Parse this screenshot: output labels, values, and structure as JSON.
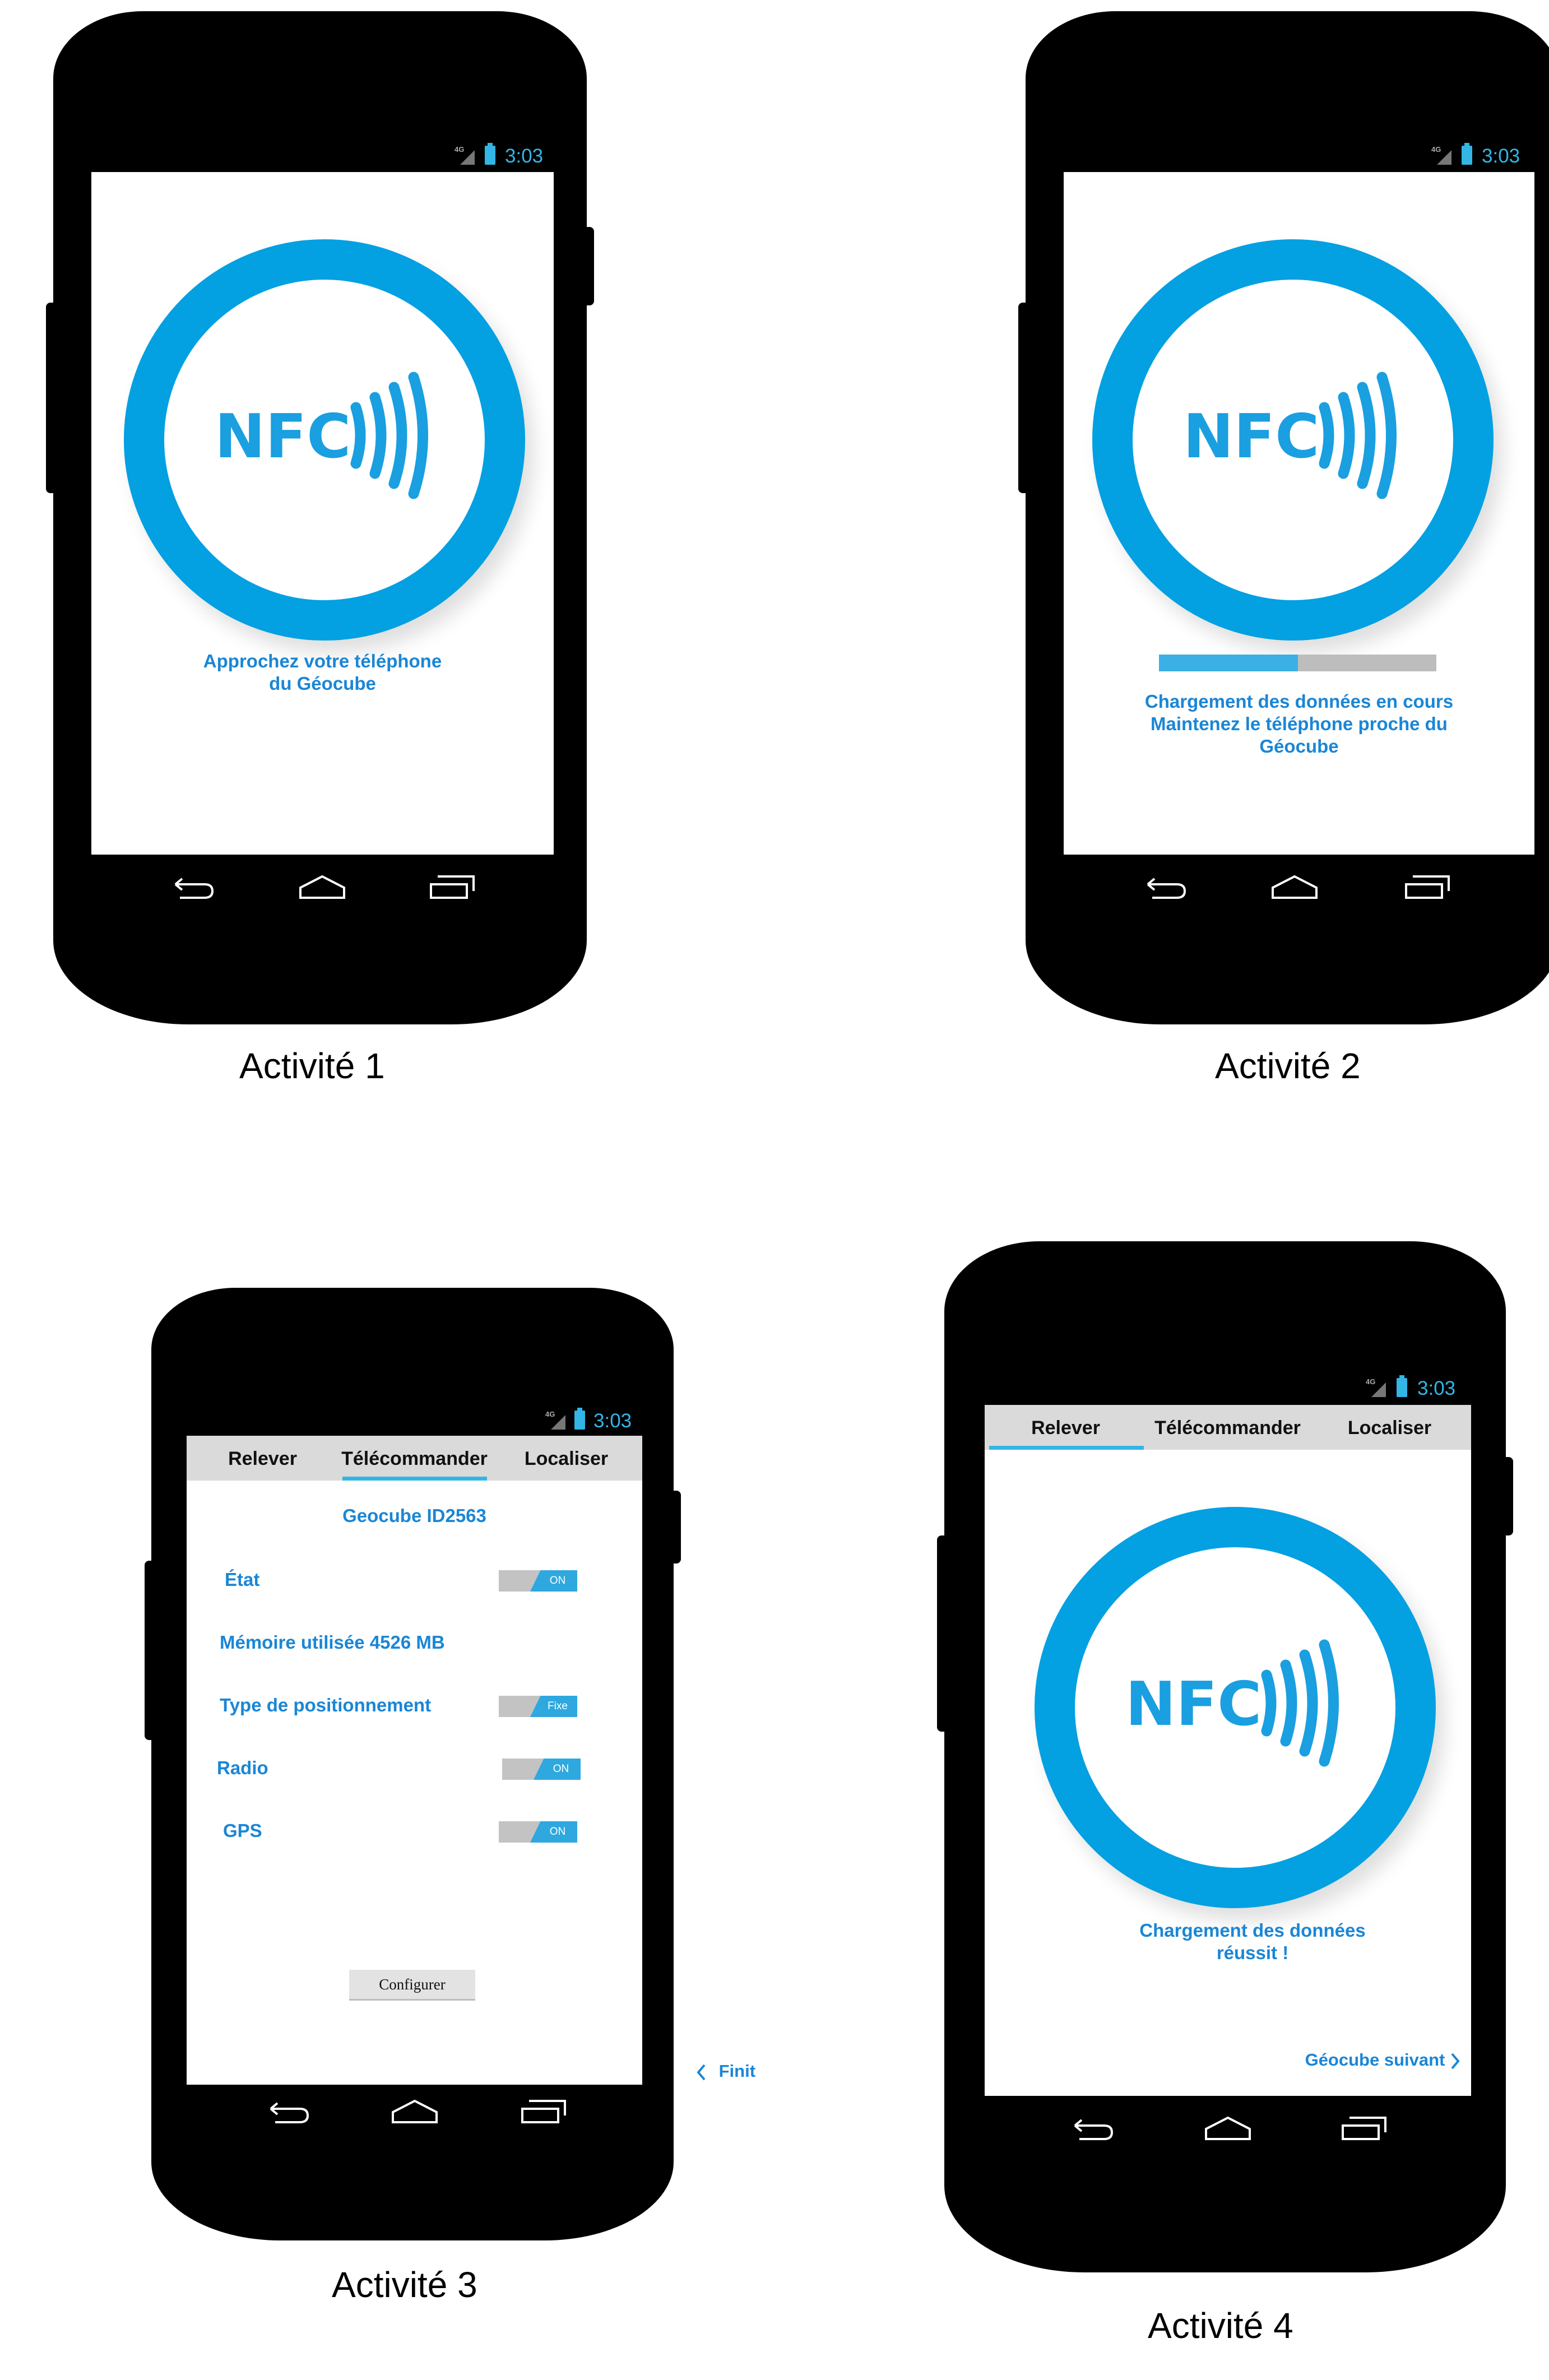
{
  "status_bar": {
    "network": "4G",
    "time": "3:03"
  },
  "nfc_logo_text": "NFC",
  "colors": {
    "accent": "#03a0e2",
    "text_blue": "#1a86d6",
    "status_blue": "#33b5e5",
    "phone_body": "#000000",
    "toggle_off": "#c3c3c3",
    "tab_bar": "#dadada"
  },
  "nav_icons": [
    "back-icon",
    "home-icon",
    "recent-apps-icon"
  ],
  "activity1": {
    "caption": "Activité 1",
    "message_line1": "Approchez votre téléphone",
    "message_line2": "du Géocube"
  },
  "activity2": {
    "caption": "Activité 2",
    "progress": 0.5,
    "message_line1": "Chargement des données en cours",
    "message_line2": "Maintenez le téléphone proche du",
    "message_line3": "Géocube"
  },
  "activity3": {
    "caption": "Activité 3",
    "tabs": [
      "Relever",
      "Télécommander",
      "Localiser"
    ],
    "active_tab": "Télécommander",
    "geocube_id": "Geocube ID2563",
    "state_label": "État",
    "state_toggle": "ON",
    "memory_label": "Mémoire utilisée 4526 MB",
    "positioning_label": "Type de positionnement",
    "positioning_toggle": "Fixe",
    "radio_label": "Radio",
    "radio_toggle": "ON",
    "gps_label": "GPS",
    "gps_toggle": "ON",
    "configure_button": "Configurer",
    "finish_link": "Finit"
  },
  "activity4": {
    "caption": "Activité 4",
    "tabs": [
      "Relever",
      "Télécommander",
      "Localiser"
    ],
    "active_tab": "Relever",
    "message_line1": "Chargement des données",
    "message_line2": "réussit !",
    "next_link": "Géocube suivant"
  }
}
